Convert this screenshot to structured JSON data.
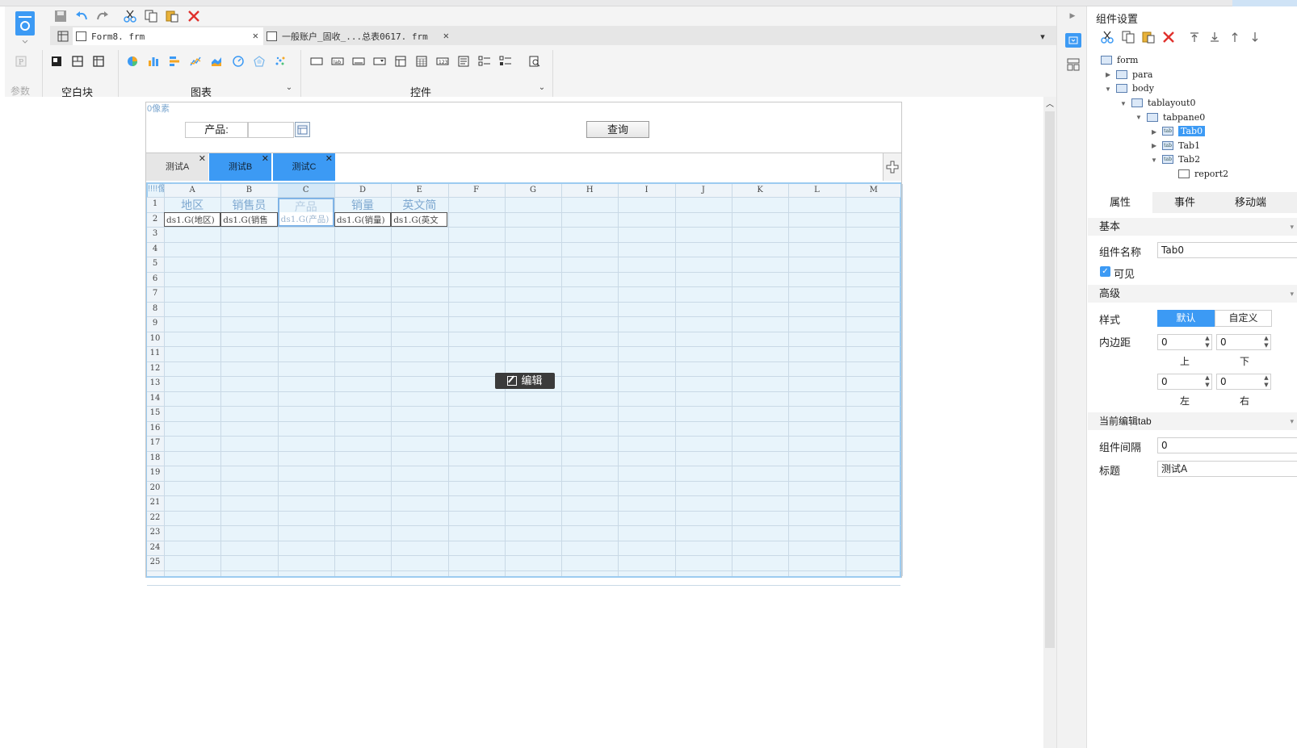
{
  "toolbar": {
    "file_tabs": [
      {
        "label": "Form8. frm"
      },
      {
        "label": "一般账户_固收_...总表0617. frm"
      }
    ],
    "params_label": "参数",
    "groups": {
      "blank_block": "空白块",
      "chart": "图表",
      "widget": "控件"
    }
  },
  "form": {
    "top_margin_label": "0像素",
    "product_label": "产品:",
    "query_button": "查询",
    "tabs": [
      "测试A",
      "测试B",
      "测试C"
    ],
    "report_margin_label": "!!!!像素",
    "edit_button": "编辑",
    "columns": [
      "A",
      "B",
      "C",
      "D",
      "E",
      "F",
      "G",
      "H",
      "I",
      "J",
      "K",
      "L",
      "M"
    ],
    "rows": [
      "1",
      "2",
      "3",
      "4",
      "5",
      "6",
      "7",
      "8",
      "9",
      "10",
      "11",
      "12",
      "13",
      "14",
      "15",
      "16",
      "17",
      "18",
      "19",
      "20",
      "21",
      "22",
      "23",
      "24",
      "25"
    ],
    "header_cells": [
      "地区",
      "销售员",
      "产品",
      "销量",
      "英文简"
    ],
    "data_cells": [
      "ds1.G(地区)",
      "ds1.G(销售",
      "ds1.G(产品)",
      "ds1.G(销量)",
      "ds1.G(英文"
    ]
  },
  "panel": {
    "title": "组件设置",
    "tree": [
      "form",
      "para",
      "body",
      "tablayout0",
      "tabpane0",
      "Tab0",
      "Tab1",
      "Tab2",
      "report2"
    ],
    "tabs": [
      "属性",
      "事件",
      "移动端"
    ],
    "sections": {
      "basic": "基本",
      "advanced": "高级",
      "current_tab": "当前编辑tab"
    },
    "component_name_label": "组件名称",
    "component_name_value": "Tab0",
    "visible_label": "可见",
    "style_label": "样式",
    "style_default": "默认",
    "style_custom": "自定义",
    "padding_label": "内边距",
    "padding": {
      "top": "0",
      "bottom": "0",
      "left": "0",
      "right": "0"
    },
    "padding_captions": {
      "top": "上",
      "bottom": "下",
      "left": "左",
      "right": "右"
    },
    "spacing_label": "组件间隔",
    "spacing_value": "0",
    "title_label": "标题",
    "title_value": "测试A"
  },
  "colors": {
    "accent": "#3c9af4",
    "tab_active": "#3c9af4",
    "delete_red": "#e0312d",
    "grid_bg": "#e8f4fb"
  }
}
